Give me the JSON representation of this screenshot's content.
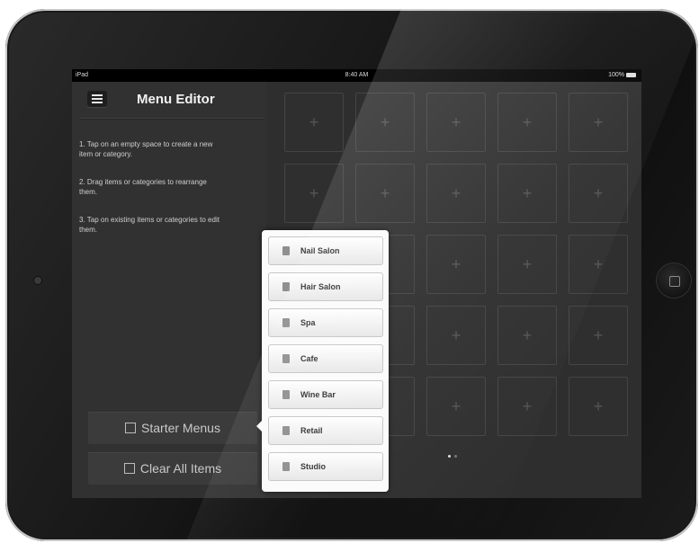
{
  "status_bar": {
    "device": "iPad",
    "time": "8:40 AM",
    "battery": "100%"
  },
  "sidebar": {
    "title": "Menu Editor",
    "instructions": [
      "1. Tap on an empty space to create a new item or category.",
      "2. Drag items or categories to rearrange them.",
      "3. Tap on existing items or categories to edit them."
    ],
    "starter_menus_label": "Starter Menus",
    "clear_all_label": "Clear All Items"
  },
  "grid": {
    "add_symbol": "+",
    "pages": 2,
    "current_page": 1
  },
  "popover": {
    "items": [
      {
        "label": "Nail Salon",
        "icon": "nail-polish-icon"
      },
      {
        "label": "Hair Salon",
        "icon": "hair-dryer-icon"
      },
      {
        "label": "Spa",
        "icon": "spa-stones-icon"
      },
      {
        "label": "Cafe",
        "icon": "coffee-cup-icon"
      },
      {
        "label": "Wine Bar",
        "icon": "wine-glass-icon"
      },
      {
        "label": "Retail",
        "icon": "shirt-icon"
      },
      {
        "label": "Studio",
        "icon": "easel-icon"
      }
    ]
  },
  "colors": {
    "screen_bg": "#2e2e2e",
    "popover_bg": "#fbfbfb",
    "title_text": "#f2f2f2"
  }
}
